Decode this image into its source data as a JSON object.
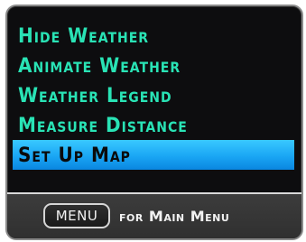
{
  "menu": {
    "items": [
      {
        "label": "Hide Weather",
        "selected": false
      },
      {
        "label": "Animate Weather",
        "selected": false
      },
      {
        "label": "Weather Legend",
        "selected": false
      },
      {
        "label": "Measure Distance",
        "selected": false
      },
      {
        "label": "Set Up Map",
        "selected": true
      }
    ]
  },
  "footer": {
    "key_label": "MENU",
    "hint_text": "for Main Menu"
  },
  "colors": {
    "item_text": "#29e3b5",
    "selected_bg": "#1aa6f4",
    "selected_text": "#0a0a0a",
    "panel_bg": "#0d0d0f",
    "footer_bg": "#353535"
  }
}
